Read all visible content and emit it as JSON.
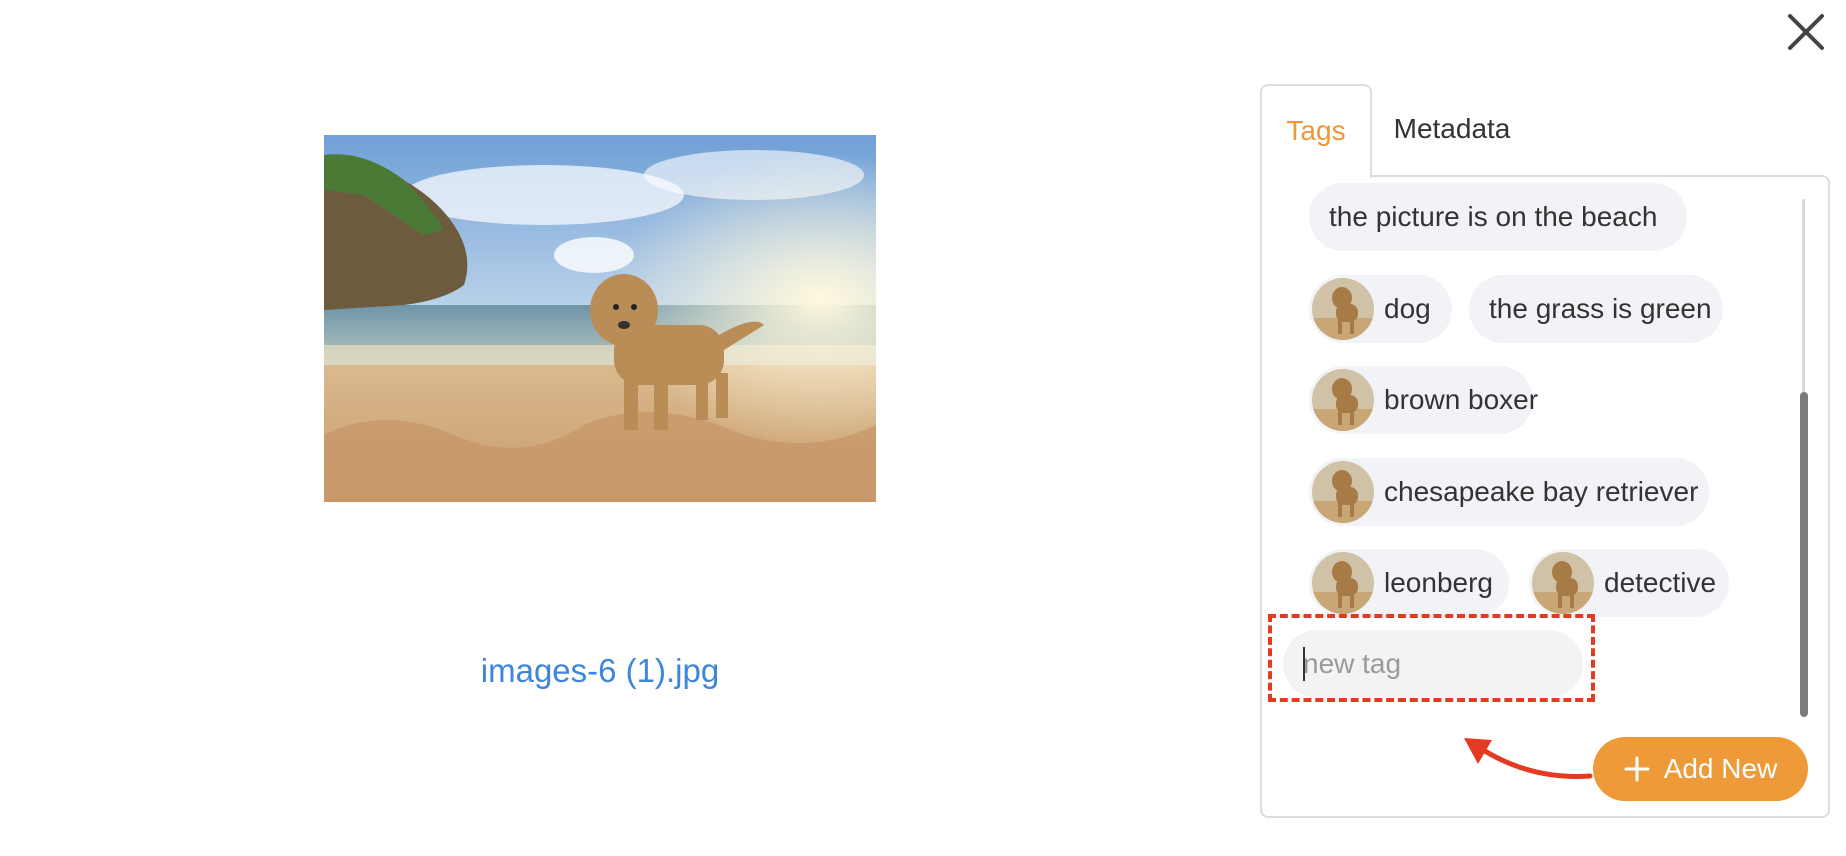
{
  "viewer": {
    "filename": "images-6 (1).jpg"
  },
  "tabs": [
    {
      "label": "Tags",
      "active": true
    },
    {
      "label": "Metadata",
      "active": false
    }
  ],
  "tags": [
    {
      "label": "the picture is on the beach",
      "has_avatar": false
    },
    {
      "label": "dog",
      "has_avatar": true
    },
    {
      "label": "the grass is green",
      "has_avatar": false
    },
    {
      "label": "brown boxer",
      "has_avatar": true
    },
    {
      "label": "chesapeake bay retriever",
      "has_avatar": true
    },
    {
      "label": "leonberg",
      "has_avatar": true
    },
    {
      "label": "detective",
      "has_avatar": true
    }
  ],
  "new_tag": {
    "placeholder": "new tag",
    "value": ""
  },
  "add_button": {
    "label": "Add New",
    "icon": "plus-icon"
  },
  "colors": {
    "accent": "#ef9a38",
    "link": "#3d86db",
    "highlight": "#e33b22"
  },
  "icons": {
    "close": "close-icon"
  }
}
